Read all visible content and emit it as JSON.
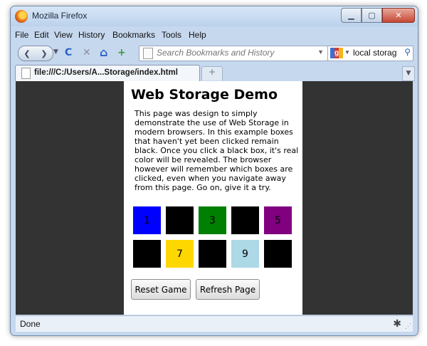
{
  "window": {
    "title": "Mozilla Firefox",
    "minimize": "▁",
    "maximize": "▢",
    "close": "✕"
  },
  "menu": [
    "File",
    "Edit",
    "View",
    "History",
    "Bookmarks",
    "Tools",
    "Help"
  ],
  "toolbar": {
    "back": "❮",
    "forward": "❯",
    "reload": "C",
    "stop": "✕",
    "home": "⌂",
    "bookmark_add": "+",
    "url_placeholder": "Search Bookmarks and History",
    "search_value": "local storag",
    "search_icon": "⚲"
  },
  "tabs": [
    {
      "label": "file:///C:/Users/A...Storage/index.html"
    }
  ],
  "newtab_label": "+",
  "page": {
    "title": "Web Storage Demo",
    "description": "This page was design to simply demonstrate the use of Web Storage in modern browsers. In this example boxes that haven't yet been clicked remain black. Once you click a black box, it's real color will be revealed. The browser however will remember which boxes are clicked, even when you navigate away from this page. Go on, give it a try.",
    "boxes": [
      {
        "label": "1",
        "color": "#0000ff"
      },
      {
        "label": "",
        "color": "#000000"
      },
      {
        "label": "3",
        "color": "#008000"
      },
      {
        "label": "",
        "color": "#000000"
      },
      {
        "label": "5",
        "color": "#800080"
      },
      {
        "label": "",
        "color": "#000000"
      },
      {
        "label": "7",
        "color": "#ffd700"
      },
      {
        "label": "",
        "color": "#000000"
      },
      {
        "label": "9",
        "color": "#add8e6"
      },
      {
        "label": "",
        "color": "#000000"
      }
    ],
    "reset_button": "Reset Game",
    "refresh_button": "Refresh Page"
  },
  "status": {
    "text": "Done"
  }
}
